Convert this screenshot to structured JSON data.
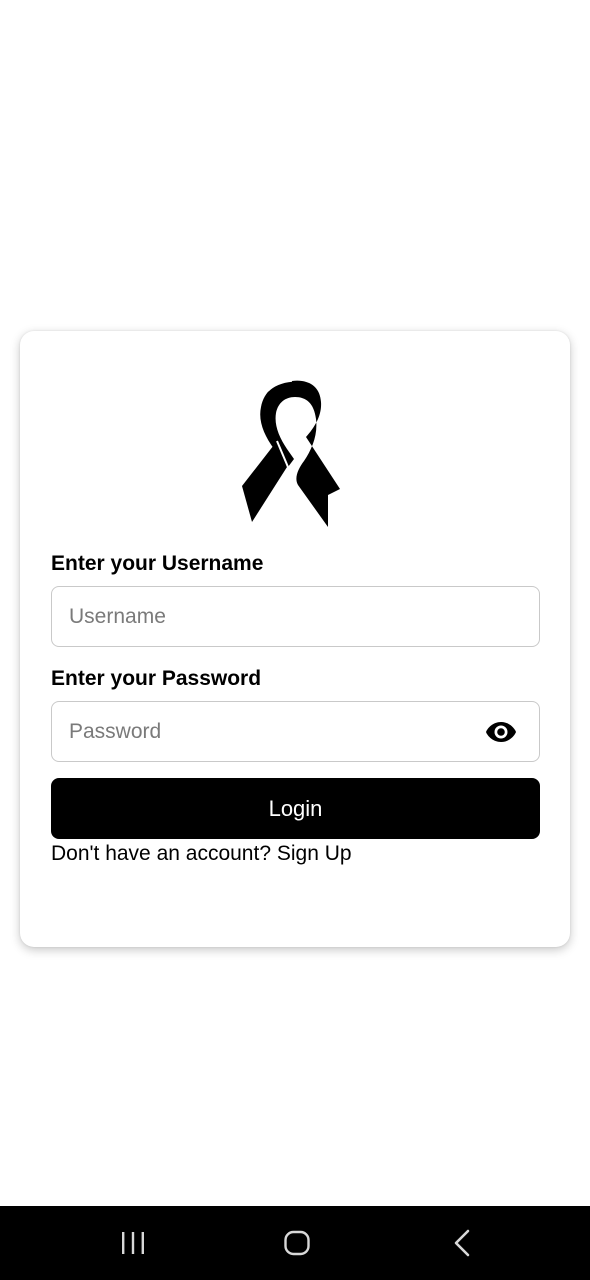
{
  "login": {
    "username_label": "Enter your Username",
    "username_placeholder": "Username",
    "username_value": "",
    "password_label": "Enter your Password",
    "password_placeholder": "Password",
    "password_value": "",
    "login_button": "Login",
    "signup_prompt": "Don't have an account?",
    "signup_link": "Sign Up"
  },
  "icons": {
    "logo": "awareness-ribbon-icon",
    "password_toggle": "eye-icon",
    "nav_recents": "recents-icon",
    "nav_home": "home-icon",
    "nav_back": "back-icon"
  },
  "colors": {
    "background": "#ffffff",
    "button": "#000000",
    "button_text": "#ffffff",
    "field_border": "#c9c9c9",
    "placeholder": "#7a7a7a",
    "navbar": "#000000"
  }
}
